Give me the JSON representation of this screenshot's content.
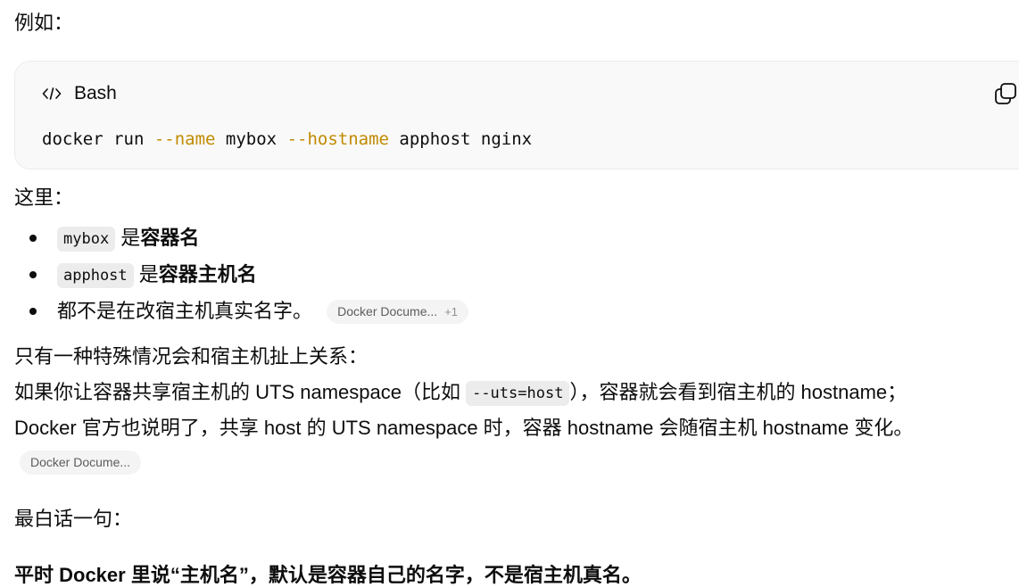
{
  "intro": "例如：",
  "code": {
    "language": "Bash",
    "icon": "code-icon",
    "copy_icon": "copy-icon",
    "tokens": {
      "t1": "docker run ",
      "t2": "--name",
      "t3": " mybox ",
      "t4": "--hostname",
      "t5": " apphost nginx"
    },
    "flag_color": "#c08b00"
  },
  "here": "这里：",
  "bullets": [
    {
      "code": "mybox",
      "text_pre": " 是",
      "bold": "容器名"
    },
    {
      "code": "apphost",
      "text_pre": " 是",
      "bold": "容器主机名"
    },
    {
      "text": "都不是在改宿主机真实名字。",
      "cite_label": "Docker Docume...",
      "cite_extra": "+1"
    }
  ],
  "special": {
    "line1": "只有一种特殊情况会和宿主机扯上关系：",
    "line2_pre": "如果你让容器共享宿主机的 UTS namespace（比如 ",
    "line2_code": "--uts=host",
    "line2_post": "），容器就会看到宿主机的 hostname；",
    "line3": "Docker 官方也说明了，共享 host 的 UTS namespace 时，容器 hostname 会随宿主机 hostname 变化。",
    "cite_label": "Docker Docume..."
  },
  "summary": {
    "heading": "最白话一句：",
    "bold": "平时 Docker 里说“主机名”，默认是容器自己的名字，不是宿主机真名。"
  }
}
